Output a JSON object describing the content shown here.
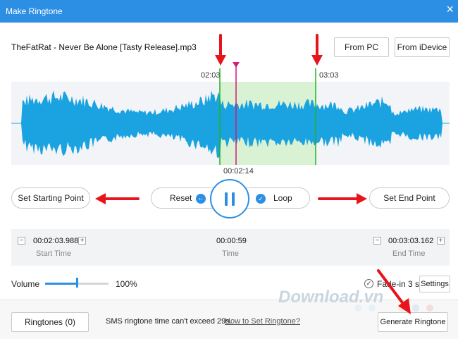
{
  "window": {
    "title": "Make Ringtone",
    "close_glyph": "×"
  },
  "file": {
    "name": "TheFatRat - Never Be Alone [Tasty Release].mp3"
  },
  "header_buttons": {
    "from_pc": "From PC",
    "from_idevice": "From iDevice"
  },
  "waveform": {
    "start_label": "02:03",
    "end_label": "03:03",
    "playhead_label": "00:02:14",
    "colors": {
      "wave": "#1aa3e0",
      "selection": "#d9f2d3",
      "marker": "#1fb51f",
      "playhead": "#d6177d",
      "background": "#f2f4f7"
    }
  },
  "controls": {
    "set_start": "Set Starting Point",
    "reset": "Reset",
    "loop": "Loop",
    "set_end": "Set End Point",
    "play_state": "pause",
    "loop_enabled": true
  },
  "time_panel": {
    "start": {
      "value": "00:02:03.988",
      "caption": "Start Time"
    },
    "duration": {
      "value": "00:00:59",
      "caption": "Time"
    },
    "end": {
      "value": "00:03:03.162",
      "caption": "End Time"
    },
    "minus_glyph": "−",
    "plus_glyph": "+"
  },
  "volume": {
    "label": "Volume",
    "value_text": "100%",
    "level": 0.5
  },
  "fade": {
    "label": "Fade-in 3 s",
    "checked": true,
    "check_glyph": "✓"
  },
  "settings_button": "Settings",
  "footer": {
    "ringtones_button": "Ringtones (0)",
    "sms_note": "SMS ringtone time can't exceed 29s.",
    "howto_link": "How to Set Ringtone?",
    "generate_button": "Generate Ringtone"
  },
  "watermark": {
    "text": "Download.vn"
  },
  "icons": {
    "close": "close-icon",
    "reset": "reset-icon",
    "loop": "loop-check-icon",
    "pause": "pause-icon",
    "fade_check": "check-circle-icon"
  },
  "accent_color": "#2d8fe4",
  "annotation_color": "#e8141b"
}
